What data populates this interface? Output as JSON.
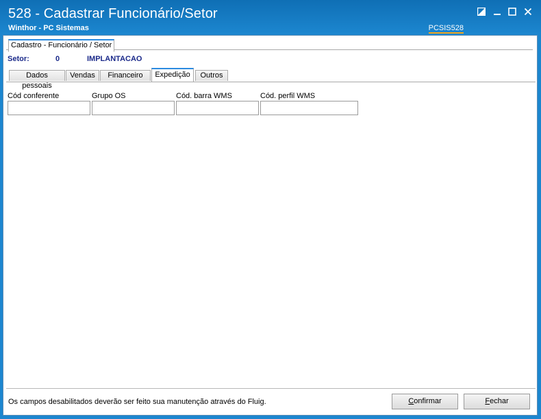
{
  "window": {
    "title": "528 - Cadastrar Funcionário/Setor",
    "subtitle": "Winthor - PC Sistemas",
    "app_code": "PCSIS528",
    "controls": [
      "restore-icon",
      "minimize-icon",
      "maximize-icon",
      "close-icon"
    ]
  },
  "main_tab": {
    "label": "Cadastro - Funcionário / Setor"
  },
  "setor": {
    "label": "Setor:",
    "code": "0",
    "name": "IMPLANTACAO"
  },
  "tabs": [
    {
      "label": "Dados pessoais",
      "active": false
    },
    {
      "label": "Vendas",
      "active": false
    },
    {
      "label": "Financeiro",
      "active": false
    },
    {
      "label": "Expedição",
      "active": true
    },
    {
      "label": "Outros",
      "active": false
    }
  ],
  "fields": [
    {
      "label": "Cód conferente",
      "value": ""
    },
    {
      "label": "Grupo OS",
      "value": ""
    },
    {
      "label": "Cód. barra WMS",
      "value": ""
    },
    {
      "label": "Cód. perfil WMS",
      "value": ""
    }
  ],
  "footer": {
    "note": "Os campos desabilitados deverão ser feito sua manutenção através do Fluig.",
    "confirm_first": "C",
    "confirm_rest": "onfirmar",
    "close_first": "F",
    "close_rest": "echar"
  },
  "colors": {
    "window_blue": "#1c86cf",
    "accent_tab": "#2b8be0",
    "appcode_underline": "#f3a61c",
    "setor_text": "#1b2a8a"
  }
}
